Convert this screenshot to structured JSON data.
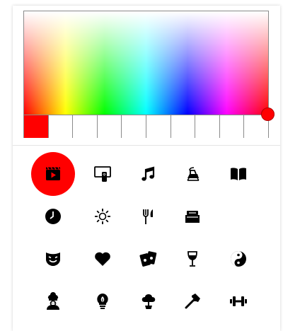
{
  "picker": {
    "selected_color": "#ff0000",
    "swatch_colors": [
      "#ff0000",
      "#ffffff",
      "#ffffff",
      "#ffffff",
      "#ffffff",
      "#ffffff",
      "#ffffff",
      "#ffffff",
      "#ffffff",
      "#ffffff"
    ],
    "hue_color": "#ff0000"
  },
  "icons": [
    {
      "name": "video-icon",
      "selected": true
    },
    {
      "name": "tv-remote-icon",
      "selected": false
    },
    {
      "name": "music-note-icon",
      "selected": false
    },
    {
      "name": "iron-icon",
      "selected": false
    },
    {
      "name": "book-icon",
      "selected": false
    },
    {
      "name": "clock-icon",
      "selected": false
    },
    {
      "name": "sun-icon",
      "selected": false
    },
    {
      "name": "fork-knife-icon",
      "selected": false
    },
    {
      "name": "stove-icon",
      "selected": false
    },
    {
      "name": "moon-icon",
      "selected": false
    },
    {
      "name": "theater-mask-icon",
      "selected": false
    },
    {
      "name": "heart-icon",
      "selected": false
    },
    {
      "name": "playing-cards-icon",
      "selected": false
    },
    {
      "name": "wine-glass-icon",
      "selected": false
    },
    {
      "name": "yin-yang-icon",
      "selected": false
    },
    {
      "name": "chef-icon",
      "selected": false
    },
    {
      "name": "lightbulb-leaf-icon",
      "selected": false
    },
    {
      "name": "tree-pot-icon",
      "selected": false
    },
    {
      "name": "hammer-icon",
      "selected": false
    },
    {
      "name": "dumbbell-icon",
      "selected": false
    }
  ]
}
